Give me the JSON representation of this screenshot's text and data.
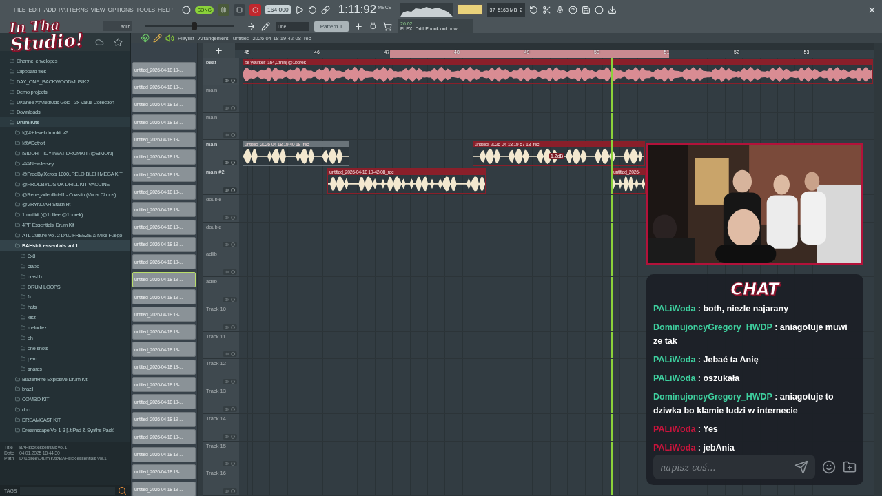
{
  "logo": {
    "line_1": "In Tha",
    "line_2": "Studio!"
  },
  "menu": [
    "FILE",
    "EDIT",
    "ADD",
    "PATTERNS",
    "VIEW",
    "OPTIONS",
    "TOOLS",
    "HELP"
  ],
  "transport": {
    "song_mode": {
      "label": "SONG",
      "selected": true
    },
    "tempo": "164.000",
    "time": "1:11:92",
    "time_unit": "MSCS",
    "memory": "5163 MB",
    "cpu": "37",
    "polyphony": "2"
  },
  "toolbar": {
    "channel": "adlib",
    "volume": {
      "level": 0.55
    },
    "snap": "Line",
    "pattern": "Pattern 1",
    "news_time": "26:02",
    "news": "FLEX: Drift Phonk out now!"
  },
  "browser": {
    "items": [
      {
        "label": "Channel envelopes",
        "expanded": false,
        "selected": false
      },
      {
        "label": "Clipboard files",
        "expanded": false,
        "selected": false
      },
      {
        "label": "DAY_ONE_BACKWOODMUSIK2",
        "expanded": false,
        "selected": false
      },
      {
        "label": "Demo projects",
        "expanded": false,
        "selected": false
      },
      {
        "label": "DKanee ##Meth0ds Gold - 3x Value Collection",
        "expanded": false,
        "selected": false
      },
      {
        "label": "Downloads",
        "expanded": false,
        "selected": false
      },
      {
        "label": "Drum Kits",
        "expanded": true,
        "selected": false,
        "children": [
          {
            "label": "!@#+ level drumkit v2",
            "expanded": false,
            "selected": false
          },
          {
            "label": "!@#Detroit",
            "expanded": false,
            "selected": false
          },
          {
            "label": "ISIDDHI - ICYTWAT DRUMKIT (@SIMON)",
            "expanded": false,
            "selected": false
          },
          {
            "label": "###NewJersey",
            "expanded": false,
            "selected": false
          },
          {
            "label": "@ProdBy.Xero's 1000..RELO BLEH MEGA KIT",
            "expanded": false,
            "selected": false
          },
          {
            "label": "@PRODBYLJS UK DRILL KIT VACCINE",
            "expanded": false,
            "selected": false
          },
          {
            "label": "@Renegadeofficial1 - Coastin (Vocal Chops)",
            "expanded": false,
            "selected": false
          },
          {
            "label": "@VRYNOAH Stash kit",
            "expanded": false,
            "selected": false
          },
          {
            "label": "1multikit (@1olliee @1borek)",
            "expanded": false,
            "selected": false
          },
          {
            "label": "4PF Essentials' Drum Kit",
            "expanded": false,
            "selected": false
          },
          {
            "label": "ATL Culture Vol. 2 Dru..IFREEZE & Mike Fuego",
            "expanded": false,
            "selected": false
          },
          {
            "label": "BAHsick essentials vol.1",
            "expanded": true,
            "selected": true,
            "children": [
              {
                "label": "8x8",
                "expanded": false,
                "selected": false
              },
              {
                "label": "claps",
                "expanded": false,
                "selected": false
              },
              {
                "label": "crashh",
                "expanded": false,
                "selected": false
              },
              {
                "label": "DRUM LOOPS",
                "expanded": false,
                "selected": false
              },
              {
                "label": "fx",
                "expanded": false,
                "selected": false
              },
              {
                "label": "hats",
                "expanded": false,
                "selected": false
              },
              {
                "label": "kikz",
                "expanded": false,
                "selected": false
              },
              {
                "label": "melodiez",
                "expanded": false,
                "selected": false
              },
              {
                "label": "oh",
                "expanded": false,
                "selected": false
              },
              {
                "label": "one shots",
                "expanded": false,
                "selected": false
              },
              {
                "label": "perc",
                "expanded": false,
                "selected": false
              },
              {
                "label": "snares",
                "expanded": false,
                "selected": false
              }
            ]
          },
          {
            "label": "Blazerfxme Explosive Drum Kit",
            "expanded": false,
            "selected": false
          },
          {
            "label": "brazil",
            "expanded": false,
            "selected": false
          },
          {
            "label": "COMBO KIT",
            "expanded": false,
            "selected": false
          },
          {
            "label": "dnb",
            "expanded": false,
            "selected": false
          },
          {
            "label": "DREAMCA$T KIT",
            "expanded": false,
            "selected": false
          },
          {
            "label": "Dreamscape Vol 1-3 [..t Pad & Synths Pack]",
            "expanded": false,
            "selected": false
          }
        ]
      }
    ],
    "info": [
      {
        "label": "Title",
        "value": "BAHsick essentials vol.1"
      },
      {
        "label": "Date",
        "value": "04.01.2025 18:44:30"
      },
      {
        "label": "Path",
        "value": "D:\\1olliee\\Drum Kits\\BAHsick essentials vol.1"
      }
    ],
    "tags_label": "TAGS"
  },
  "clip_list": [
    {
      "name": "untitled_2026-04-18 19-...",
      "selected": false
    },
    {
      "name": "untitled_2026-04-18 19-...",
      "selected": false
    },
    {
      "name": "untitled_2026-04-18 19-...",
      "selected": false
    },
    {
      "name": "untitled_2026-04-18 19-...",
      "selected": false
    },
    {
      "name": "untitled_2026-04-18 19-...",
      "selected": false
    },
    {
      "name": "untitled_2026-04-18 19-...",
      "selected": false
    },
    {
      "name": "untitled_2026-04-18 19-...",
      "selected": false
    },
    {
      "name": "untitled_2026-04-18 19-...",
      "selected": false
    },
    {
      "name": "untitled_2026-04-18 19-...",
      "selected": false
    },
    {
      "name": "untitled_2026-04-18 19-...",
      "selected": false
    },
    {
      "name": "untitled_2026-04-18 19-...",
      "selected": false
    },
    {
      "name": "untitled_2026-04-18 19-...",
      "selected": false
    },
    {
      "name": "untitled_2026-04-18 19-...",
      "selected": true
    },
    {
      "name": "untitled_2026-04-18 19-...",
      "selected": false
    },
    {
      "name": "untitled_2026-04-18 19-...",
      "selected": false
    },
    {
      "name": "untitled_2026-04-18 19-...",
      "selected": false
    },
    {
      "name": "untitled_2026-04-18 19-...",
      "selected": false
    },
    {
      "name": "untitled_2026-04-18 19-...",
      "selected": false
    },
    {
      "name": "untitled_2026-04-18 19-...",
      "selected": false
    },
    {
      "name": "untitled_2026-04-18 19-...",
      "selected": false
    },
    {
      "name": "untitled_2026-04-18 19-...",
      "selected": false
    },
    {
      "name": "untitled_2026-04-18 19-...",
      "selected": false
    },
    {
      "name": "untitled_2026-04-18 19-...",
      "selected": false
    },
    {
      "name": "untitled_2026-04-18 19-...",
      "selected": false
    },
    {
      "name": "untitled_2026-04-18 19-...",
      "selected": false
    }
  ],
  "playlist": {
    "title": "Playlist - Arrangement - untitled_2026-04-18 19-42-08_rec",
    "ruler": [
      "45",
      "46",
      "47",
      "48",
      "49",
      "50",
      "51",
      "52",
      "53"
    ],
    "tracks": [
      {
        "name": "beat",
        "muted": false,
        "clips": [
          {
            "name": "be yourself [164,Cmin] @1borek_",
            "selected": true
          }
        ]
      },
      {
        "name": "main",
        "muted": true
      },
      {
        "name": "main",
        "muted": true
      },
      {
        "name": "main",
        "muted": false,
        "clips": [
          {
            "name": "untitled_2026-04-18 19-40-18_rec",
            "selected": false
          },
          {
            "name": "untitled_2026-04-18 19-57-18_rec",
            "selected": true,
            "gain_label": "1.2dB"
          }
        ]
      },
      {
        "name": "main #2",
        "muted": false,
        "clips": [
          {
            "name": "untitled_2026-04-18 19-42-08_rec",
            "selected": true
          },
          {
            "name": "untitled_2026-",
            "selected": true
          }
        ]
      },
      {
        "name": "double",
        "muted": true
      },
      {
        "name": "double",
        "muted": true
      },
      {
        "name": "adlib",
        "muted": true
      },
      {
        "name": "adlib",
        "muted": true
      },
      {
        "name": "Track 10",
        "muted": true
      },
      {
        "name": "Track 11",
        "muted": true
      },
      {
        "name": "Track 12",
        "muted": true
      },
      {
        "name": "Track 13",
        "muted": true
      },
      {
        "name": "Track 14",
        "muted": true
      },
      {
        "name": "Track 15",
        "muted": true
      },
      {
        "name": "Track 16",
        "muted": true
      }
    ]
  },
  "webcam": {
    "kind": "picture"
  },
  "chat": {
    "title": "CHAT",
    "separator": ":",
    "messages": [
      {
        "user": "PALiWoda",
        "color": "#3ecf9e",
        "text": "both, niezle najarany"
      },
      {
        "user": "DominujoncyGregory_HWDP",
        "color": "#3ecf9e",
        "text": "aniagotuje muwi ze tak"
      },
      {
        "user": "PALiWoda",
        "color": "#3ecf9e",
        "text": "Jebać ta Anię"
      },
      {
        "user": "PALiWoda",
        "color": "#3ecf9e",
        "text": "oszukała"
      },
      {
        "user": "DominujoncyGregory_HWDP",
        "color": "#3ecf9e",
        "text": "aniagotuje to dziwka bo klamie ludzi w internecie"
      },
      {
        "user": "PALiWoda",
        "color": "#c8143c",
        "text": "Yes"
      },
      {
        "user": "PALiWoda",
        "color": "#c8143c",
        "text": "jebAnia"
      }
    ],
    "placeholder": "napisz coś..."
  }
}
